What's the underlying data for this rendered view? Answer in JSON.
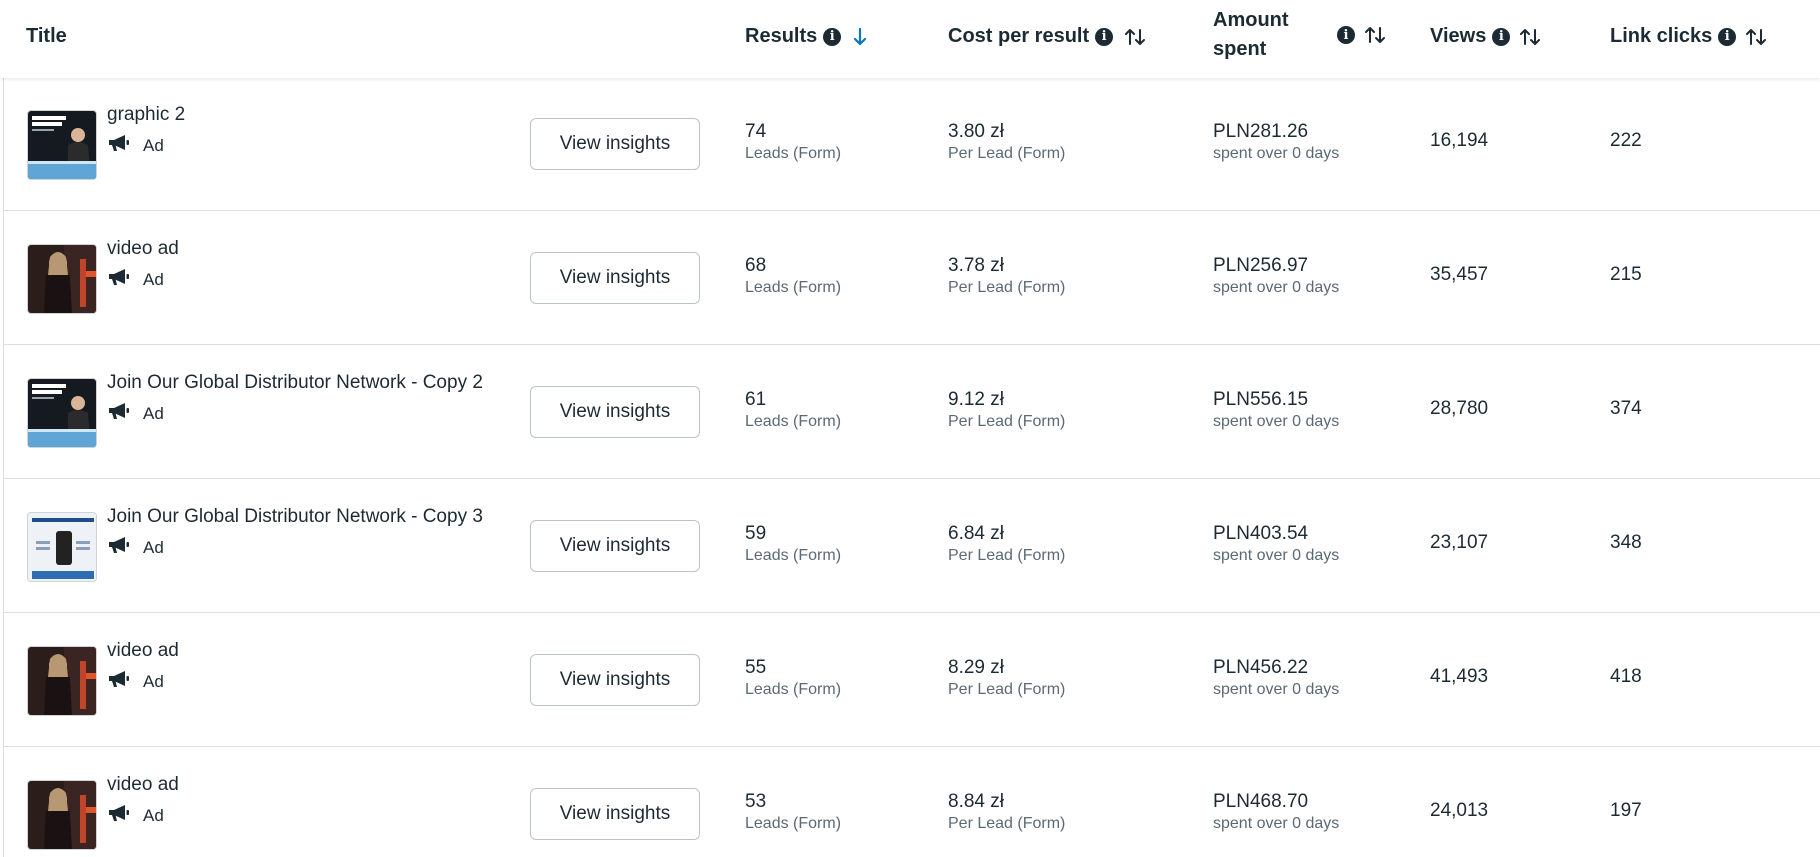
{
  "columns": {
    "title": "Title",
    "results": "Results",
    "cost_per_result": "Cost per result",
    "amount_spent_line1": "Amount",
    "amount_spent_line2": "spent",
    "views": "Views",
    "link_clicks": "Link clicks"
  },
  "sort": {
    "active_column": "results",
    "direction": "descending"
  },
  "colors": {
    "accent": "#0a78be",
    "text": "#1c2b33",
    "muted": "#5a6a74",
    "border": "#dadde1"
  },
  "button_label": "View insights",
  "rows": [
    {
      "title": "graphic 2",
      "type": "Ad",
      "thumbnail": "distributor-graphic",
      "results": "74",
      "results_label": "Leads (Form)",
      "cost": "3.80 zł",
      "cost_label": "Per Lead (Form)",
      "amount": "PLN281.26",
      "amount_label": "spent over 0 days",
      "views": "16,194",
      "link_clicks": "222"
    },
    {
      "title": "video ad",
      "type": "Ad",
      "thumbnail": "video-still",
      "results": "68",
      "results_label": "Leads (Form)",
      "cost": "3.78 zł",
      "cost_label": "Per Lead (Form)",
      "amount": "PLN256.97",
      "amount_label": "spent over 0 days",
      "views": "35,457",
      "link_clicks": "215"
    },
    {
      "title": "Join Our Global Distributor Network - Copy 2",
      "type": "Ad",
      "thumbnail": "distributor-graphic",
      "results": "61",
      "results_label": "Leads (Form)",
      "cost": "9.12 zł",
      "cost_label": "Per Lead (Form)",
      "amount": "PLN556.15",
      "amount_label": "spent over 0 days",
      "views": "28,780",
      "link_clicks": "374"
    },
    {
      "title": "Join Our Global Distributor Network - Copy 3",
      "type": "Ad",
      "thumbnail": "product-banner",
      "results": "59",
      "results_label": "Leads (Form)",
      "cost": "6.84 zł",
      "cost_label": "Per Lead (Form)",
      "amount": "PLN403.54",
      "amount_label": "spent over 0 days",
      "views": "23,107",
      "link_clicks": "348"
    },
    {
      "title": "video ad",
      "type": "Ad",
      "thumbnail": "video-still",
      "results": "55",
      "results_label": "Leads (Form)",
      "cost": "8.29 zł",
      "cost_label": "Per Lead (Form)",
      "amount": "PLN456.22",
      "amount_label": "spent over 0 days",
      "views": "41,493",
      "link_clicks": "418"
    },
    {
      "title": "video ad",
      "type": "Ad",
      "thumbnail": "video-still",
      "results": "53",
      "results_label": "Leads (Form)",
      "cost": "8.84 zł",
      "cost_label": "Per Lead (Form)",
      "amount": "PLN468.70",
      "amount_label": "spent over 0 days",
      "views": "24,013",
      "link_clicks": "197"
    }
  ]
}
